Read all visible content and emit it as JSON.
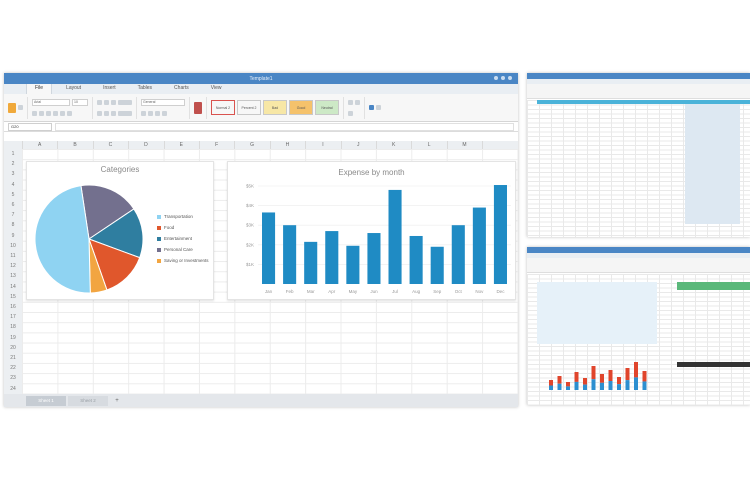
{
  "app": {
    "title": "Template1"
  },
  "menu": {
    "tabs": [
      "File",
      "Layout",
      "Insert",
      "Tables",
      "Charts",
      "View"
    ],
    "active": "File"
  },
  "ribbon": {
    "font_name": "Arial",
    "font_size": "10",
    "number_format": "General",
    "styles": [
      "Normal 2",
      "Percent 2",
      "Bad",
      "Good",
      "Neutral"
    ]
  },
  "formula_bar": {
    "cell_ref": "G20"
  },
  "sheet": {
    "columns": [
      "A",
      "B",
      "C",
      "D",
      "E",
      "F",
      "G",
      "H",
      "I",
      "J",
      "K",
      "L",
      "M"
    ],
    "rows": [
      "1",
      "2",
      "3",
      "4",
      "5",
      "6",
      "7",
      "8",
      "9",
      "10",
      "11",
      "12",
      "13",
      "14",
      "15",
      "16",
      "17",
      "18",
      "19",
      "20",
      "21",
      "22",
      "23",
      "24"
    ],
    "tabs": [
      "Sheet 1",
      "Sheet 2"
    ],
    "add_label": "+"
  },
  "chart_data": [
    {
      "type": "pie",
      "title": "Categories",
      "categories": [
        "Transportation",
        "Food",
        "Entertainment",
        "Personal Care",
        "Saving or Investments"
      ],
      "values": [
        48,
        14,
        15,
        18,
        5
      ],
      "colors": [
        "#8fd3f2",
        "#e0572c",
        "#2f7ea0",
        "#73708e",
        "#f2a541"
      ],
      "legend": "right"
    },
    {
      "type": "bar",
      "title": "Expense by month",
      "categories": [
        "Jan",
        "Feb",
        "Mar",
        "Apr",
        "May",
        "Jun",
        "Jul",
        "Aug",
        "Sep",
        "Oct",
        "Nov",
        "Dec"
      ],
      "values": [
        3650,
        3000,
        2150,
        2700,
        1950,
        2600,
        4800,
        2450,
        1900,
        3000,
        3900,
        5050
      ],
      "yticks": [
        "$1K",
        "$2K",
        "$3K",
        "$4K",
        "$5K"
      ],
      "ylim": [
        0,
        5000
      ],
      "color": "#1f8bc4",
      "grid": true
    }
  ]
}
